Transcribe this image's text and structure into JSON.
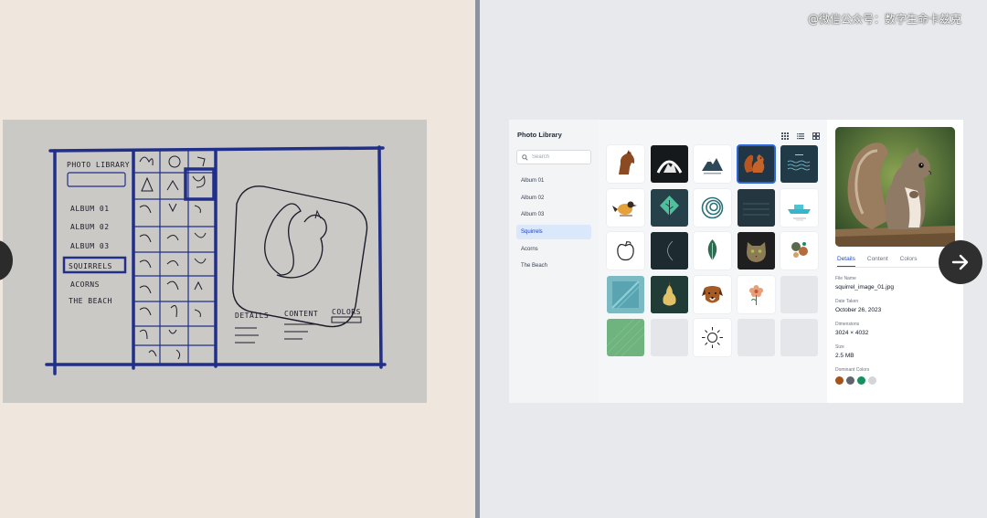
{
  "watermark": "@微信公众号：数字生命卡兹克",
  "sketch": {
    "title": "PHOTO LIBRARY",
    "albums": [
      "ALBUM 01",
      "ALBUM 02",
      "ALBUM 03",
      "SQUIRRELS",
      "ACORNS",
      "THE BEACH"
    ],
    "tabs": [
      "DETAILS",
      "CONTENT",
      "COLORS"
    ]
  },
  "app": {
    "title": "Photo Library",
    "search_placeholder": "Search",
    "albums": [
      {
        "label": "Album 01"
      },
      {
        "label": "Album 02"
      },
      {
        "label": "Album 03"
      },
      {
        "label": "Squirrels",
        "active": true
      },
      {
        "label": "Acorns"
      },
      {
        "label": "The Beach"
      }
    ],
    "view_modes": [
      "grid-small-icon",
      "list-icon",
      "grid-large-icon"
    ],
    "thumbnails": [
      {
        "subject": "horse",
        "style": "white"
      },
      {
        "subject": "mountain-arch",
        "style": "darkest"
      },
      {
        "subject": "mountains",
        "style": "white"
      },
      {
        "subject": "squirrel",
        "style": "selected"
      },
      {
        "subject": "waves",
        "style": "navy"
      },
      {
        "subject": "bird",
        "style": "white"
      },
      {
        "subject": "tree",
        "style": "teal"
      },
      {
        "subject": "spiral",
        "style": "white"
      },
      {
        "subject": "water-block",
        "style": "teal"
      },
      {
        "subject": "boat",
        "style": "white"
      },
      {
        "subject": "apple",
        "style": "white"
      },
      {
        "subject": "moon",
        "style": "dark"
      },
      {
        "subject": "leaf",
        "style": "white"
      },
      {
        "subject": "cat",
        "style": "dark"
      },
      {
        "subject": "abstract-shapes",
        "style": "white"
      },
      {
        "subject": "teal-texture",
        "style": "color"
      },
      {
        "subject": "pear",
        "style": "dark"
      },
      {
        "subject": "dog",
        "style": "white"
      },
      {
        "subject": "flower",
        "style": "white"
      },
      {
        "subject": "empty",
        "style": "empty"
      },
      {
        "subject": "green-texture",
        "style": "color"
      },
      {
        "subject": "empty",
        "style": "empty"
      },
      {
        "subject": "sun",
        "style": "white"
      },
      {
        "subject": "empty",
        "style": "empty"
      },
      {
        "subject": "empty",
        "style": "empty"
      }
    ],
    "details": {
      "tabs": [
        {
          "label": "Details",
          "active": true
        },
        {
          "label": "Content"
        },
        {
          "label": "Colors"
        }
      ],
      "file_name_label": "File Name",
      "file_name": "squirrel_image_01.jpg",
      "date_label": "Date Taken",
      "date": "October 26, 2023",
      "dimensions_label": "Dimensions",
      "dimensions": "3024 × 4032",
      "size_label": "Size",
      "size": "2.5 MB",
      "colors_label": "Dominant Colors",
      "dominant_colors": [
        "#a2541c",
        "#5f6470",
        "#159061",
        "#d3d5d9"
      ]
    }
  }
}
